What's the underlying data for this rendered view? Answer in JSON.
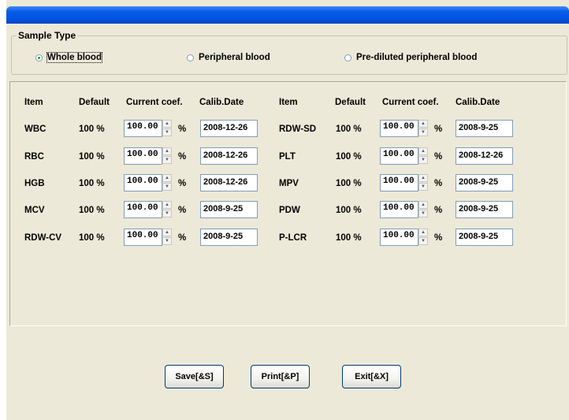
{
  "window": {
    "title": ""
  },
  "sample_type": {
    "legend": "Sample Type",
    "options": [
      {
        "label": "Whole blood",
        "selected": true
      },
      {
        "label": "Peripheral blood",
        "selected": false
      },
      {
        "label": "Pre-diluted peripheral blood",
        "selected": false
      }
    ]
  },
  "table": {
    "headers": {
      "item": "Item",
      "default": "Default",
      "current": "Current coef.",
      "calib": "Calib.Date"
    },
    "percent_sign": "%",
    "left_rows": [
      {
        "item": "WBC",
        "default": "100 %",
        "coef": "100.00",
        "date": "2008-12-26"
      },
      {
        "item": "RBC",
        "default": "100 %",
        "coef": "100.00",
        "date": "2008-12-26"
      },
      {
        "item": "HGB",
        "default": "100 %",
        "coef": "100.00",
        "date": "2008-12-26"
      },
      {
        "item": "MCV",
        "default": "100 %",
        "coef": "100.00",
        "date": "2008-9-25"
      },
      {
        "item": "RDW-CV",
        "default": "100 %",
        "coef": "100.00",
        "date": "2008-9-25"
      }
    ],
    "right_rows": [
      {
        "item": "RDW-SD",
        "default": "100 %",
        "coef": "100.00",
        "date": "2008-9-25"
      },
      {
        "item": "PLT",
        "default": "100 %",
        "coef": "100.00",
        "date": "2008-12-26"
      },
      {
        "item": "MPV",
        "default": "100 %",
        "coef": "100.00",
        "date": "2008-9-25"
      },
      {
        "item": "PDW",
        "default": "100 %",
        "coef": "100.00",
        "date": "2008-9-25"
      },
      {
        "item": "P-LCR",
        "default": "100 %",
        "coef": "100.00",
        "date": "2008-9-25"
      }
    ]
  },
  "buttons": {
    "save": "Save[&S]",
    "print": "Print[&P]",
    "exit": "Exit[&X]"
  },
  "colors": {
    "titlebar": "#0054e3",
    "dialog_bg": "#ece9d8",
    "radio_dot": "#21a121"
  }
}
